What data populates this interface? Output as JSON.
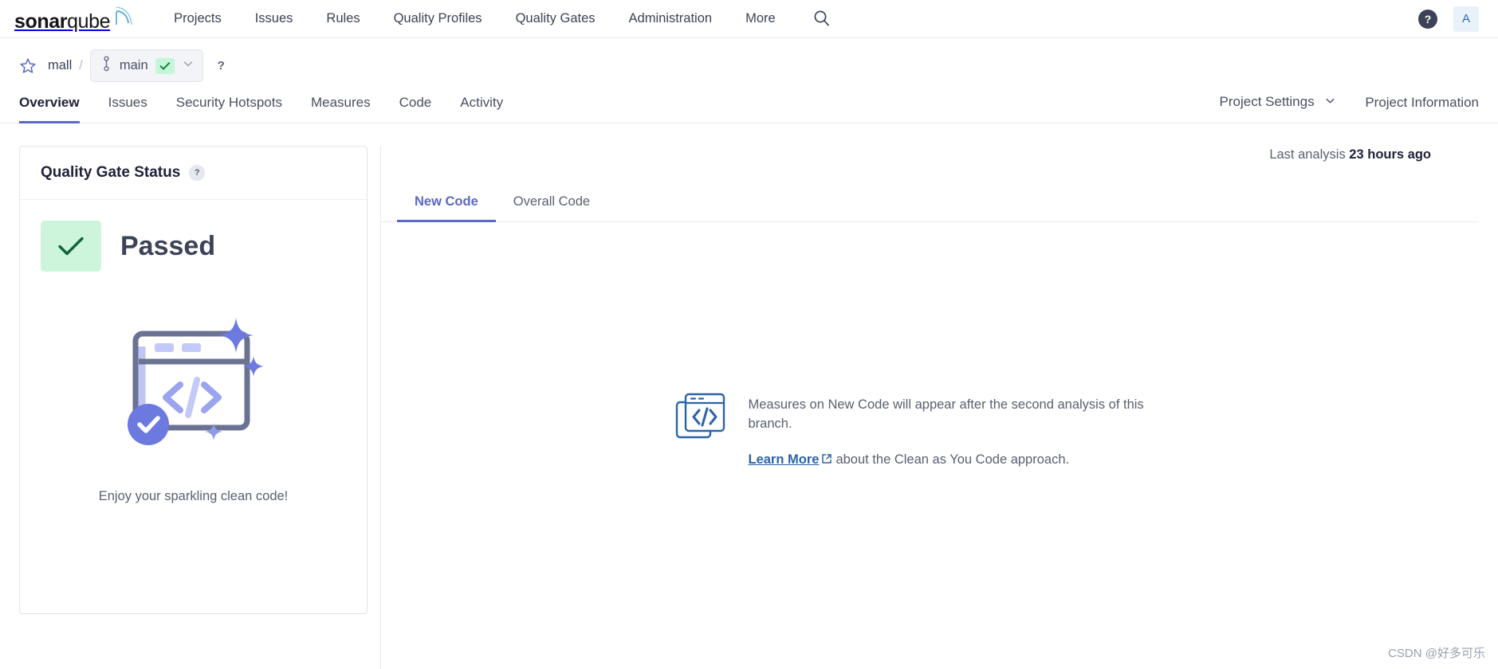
{
  "header": {
    "logo": {
      "bold": "sonar",
      "light": "qube",
      "icon": "sonar-waves-icon"
    },
    "nav": [
      {
        "label": "Projects"
      },
      {
        "label": "Issues"
      },
      {
        "label": "Rules"
      },
      {
        "label": "Quality Profiles"
      },
      {
        "label": "Quality Gates"
      },
      {
        "label": "Administration"
      },
      {
        "label": "More"
      }
    ],
    "search_icon": "search-icon",
    "help_icon": "question-mark-icon",
    "help_label": "?",
    "avatar_label": "A"
  },
  "project_bar": {
    "star_icon": "star-outline-icon",
    "project_name": "mall",
    "separator": "/",
    "branch_icon": "branch-icon",
    "branch_name": "main",
    "branch_status_icon": "check-icon",
    "branch_dropdown_icon": "chevron-down-icon",
    "help_label": "?"
  },
  "project_tabs": {
    "items": [
      {
        "label": "Overview",
        "active": true
      },
      {
        "label": "Issues",
        "active": false
      },
      {
        "label": "Security Hotspots",
        "active": false
      },
      {
        "label": "Measures",
        "active": false
      },
      {
        "label": "Code",
        "active": false
      },
      {
        "label": "Activity",
        "active": false
      }
    ],
    "right": [
      {
        "label": "Project Settings",
        "has_chevron": true
      },
      {
        "label": "Project Information",
        "has_chevron": false
      }
    ]
  },
  "quality_gate": {
    "title": "Quality Gate Status",
    "help_label": "?",
    "status": "Passed",
    "status_icon": "check-icon",
    "illustration": "sparkling-clean-code-illustration",
    "caption": "Enjoy your sparkling clean code!"
  },
  "analysis": {
    "prefix": "Last analysis",
    "value": "23 hours ago"
  },
  "code_tabs": [
    {
      "label": "New Code",
      "active": true
    },
    {
      "label": "Overall Code",
      "active": false
    }
  ],
  "empty_state": {
    "icon": "code-window-icon",
    "message": "Measures on New Code will appear after the second analysis of this branch.",
    "link_text": "Learn More",
    "link_icon": "external-link-icon",
    "link_suffix": "about the Clean as You Code approach."
  },
  "watermark": "CSDN @好多可乐",
  "colors": {
    "accent": "#5b68c4",
    "link": "#2b63a8",
    "pass_green_bg": "#ccf5dc",
    "pass_green_fg": "#0b6b3a",
    "text_dark": "#20223a",
    "text_muted": "#5a6072",
    "border": "#e3e5ed"
  }
}
